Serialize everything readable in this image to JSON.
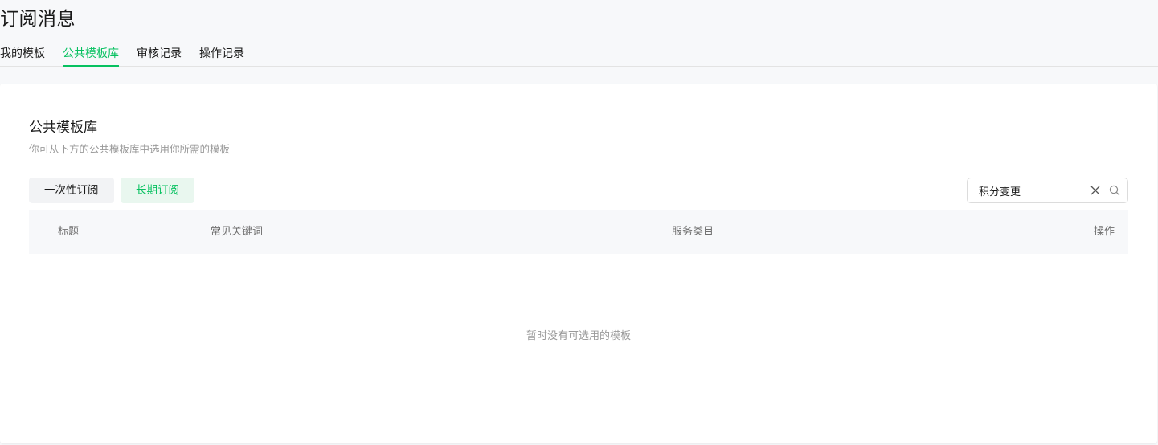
{
  "page": {
    "title": "订阅消息"
  },
  "tabs": [
    {
      "label": "我的模板",
      "active": false
    },
    {
      "label": "公共模板库",
      "active": true
    },
    {
      "label": "审核记录",
      "active": false
    },
    {
      "label": "操作记录",
      "active": false
    }
  ],
  "section": {
    "title": "公共模板库",
    "description": "你可从下方的公共模板库中选用你所需的模板"
  },
  "filters": {
    "once_label": "一次性订阅",
    "long_label": "长期订阅",
    "selected": "长期订阅"
  },
  "search": {
    "value": "积分变更"
  },
  "table": {
    "columns": [
      "标题",
      "常见关键词",
      "服务类目",
      "操作"
    ],
    "rows": [],
    "empty_text": "暂时没有可选用的模板"
  },
  "colors": {
    "accent": "#07c160",
    "accent_bg": "#e9f7ef",
    "muted_text": "#9a9a9a"
  },
  "icons": [
    "close-icon",
    "search-icon"
  ]
}
